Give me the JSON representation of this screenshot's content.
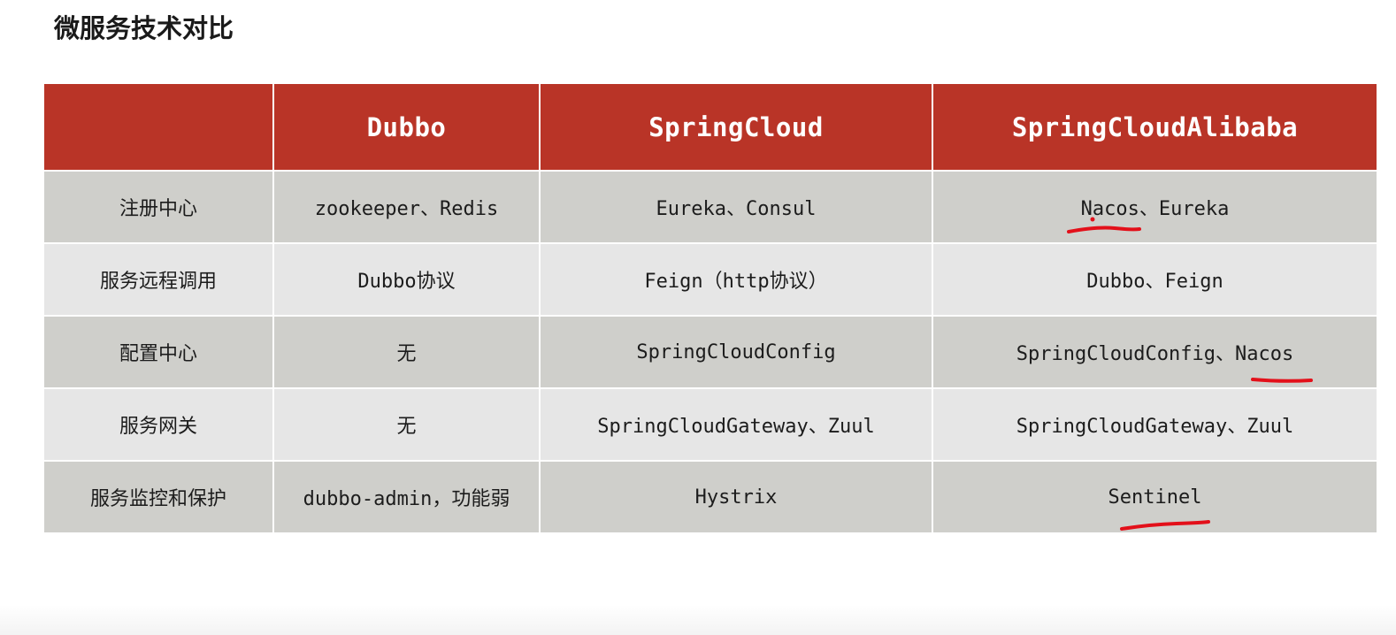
{
  "page": {
    "title": "微服务技术对比"
  },
  "table": {
    "headers": [
      "",
      "Dubbo",
      "SpringCloud",
      "SpringCloudAlibaba"
    ],
    "rows": [
      [
        "注册中心",
        "zookeeper、Redis",
        "Eureka、Consul",
        "Nacos、Eureka"
      ],
      [
        "服务远程调用",
        "Dubbo协议",
        "Feign（http协议）",
        "Dubbo、Feign"
      ],
      [
        "配置中心",
        "无",
        "SpringCloudConfig",
        "SpringCloudConfig、Nacos"
      ],
      [
        "服务网关",
        "无",
        "SpringCloudGateway、Zuul",
        "SpringCloudGateway、Zuul"
      ],
      [
        "服务监控和保护",
        "dubbo-admin，功能弱",
        "Hystrix",
        "Sentinel"
      ]
    ]
  },
  "colors": {
    "header_bg": "#b93427",
    "row_odd_bg": "#cfcfcb",
    "row_even_bg": "#e6e6e6",
    "annotation": "#e3101a"
  }
}
